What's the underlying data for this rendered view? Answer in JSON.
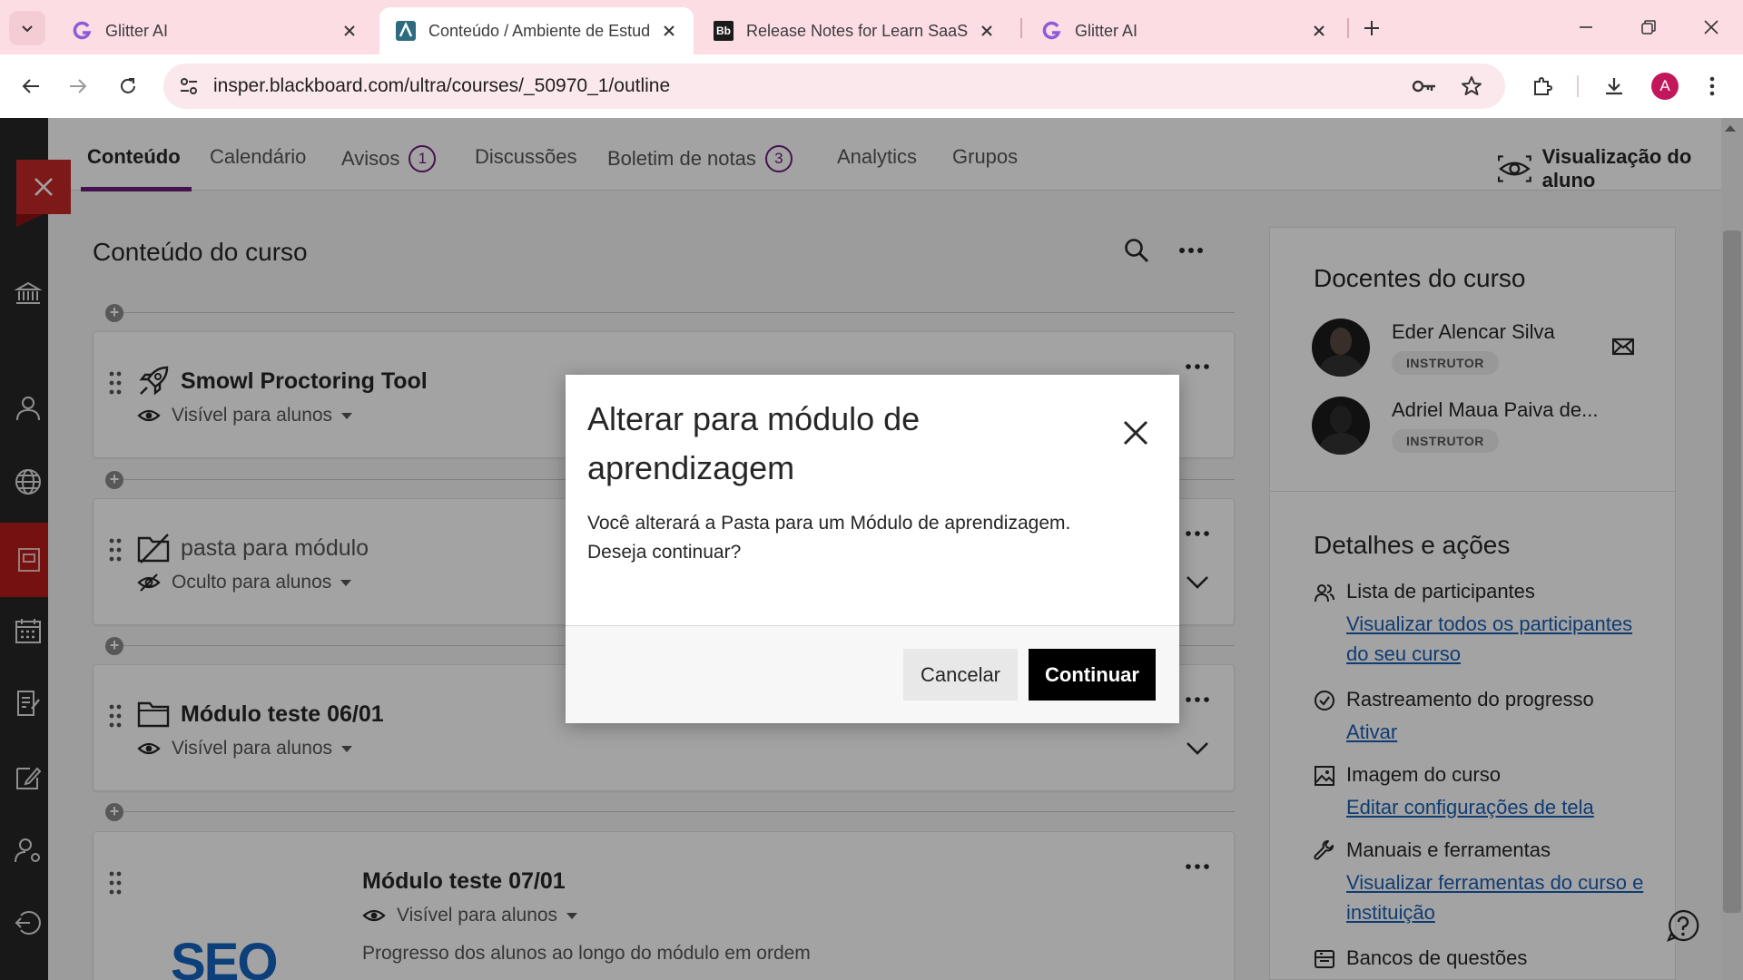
{
  "browser": {
    "tabs": [
      {
        "title": "Glitter AI",
        "favicon": "glitter-g-icon"
      },
      {
        "title": "Conteúdo / Ambiente de Estud",
        "favicon": "ambiente-icon"
      },
      {
        "title": "Release Notes for Learn SaaS | /",
        "favicon": "bb-icon",
        "favicon_text": "Bb"
      },
      {
        "title": "Glitter AI",
        "favicon": "glitter-g-icon"
      }
    ],
    "url": "insper.blackboard.com/ultra/courses/_50970_1/outline",
    "profile_initial": "A",
    "colors": {
      "tabstrip": "#fbdde3",
      "omnibox": "#fbe8ec",
      "profile": "#c2185b"
    }
  },
  "course_nav": {
    "tabs": [
      {
        "label": "Conteúdo"
      },
      {
        "label": "Calendário"
      },
      {
        "label": "Avisos",
        "badge": "1"
      },
      {
        "label": "Discussões"
      },
      {
        "label": "Boletim de notas",
        "badge": "3"
      },
      {
        "label": "Analytics"
      },
      {
        "label": "Grupos"
      }
    ],
    "student_view_label": "Visualização do aluno",
    "accent_color": "#6b1d7a"
  },
  "content": {
    "title": "Conteúdo do curso",
    "items": [
      {
        "title": "Smowl Proctoring Tool",
        "visibility": "Visível para alunos",
        "icon": "rocket-icon"
      },
      {
        "title": "pasta para módulo",
        "visibility": "Oculto para alunos",
        "icon": "folder-hidden-icon"
      },
      {
        "title": "Módulo teste 06/01",
        "visibility": "Visível para alunos",
        "icon": "folder-icon"
      },
      {
        "title": "Módulo teste 07/01",
        "visibility": "Visível para alunos",
        "description": "Progresso dos alunos ao longo do módulo em ordem",
        "image_text": "SEO"
      }
    ]
  },
  "sidebar": {
    "instructors_title": "Docentes do curso",
    "instructors": [
      {
        "name": "Eder Alencar Silva",
        "role": "INSTRUTOR"
      },
      {
        "name": "Adriel Maua Paiva de...",
        "role": "INSTRUTOR"
      }
    ],
    "details_title": "Detalhes e ações",
    "details": [
      {
        "title": "Lista de participantes",
        "link": "Visualizar todos os participantes do seu curso",
        "icon": "people-icon"
      },
      {
        "title": "Rastreamento do progresso",
        "link": "Ativar",
        "icon": "check-circle-icon"
      },
      {
        "title": "Imagem do curso",
        "link": "Editar configurações de tela",
        "icon": "image-icon"
      },
      {
        "title": "Manuais e ferramentas",
        "link": "Visualizar ferramentas do curso e instituição",
        "icon": "wrench-icon"
      },
      {
        "title": "Bancos de questões",
        "link": "",
        "icon": "bank-icon"
      }
    ]
  },
  "modal": {
    "title": "Alterar para módulo de aprendizagem",
    "body": "Você alterará a Pasta para um Módulo de aprendizagem. Deseja continuar?",
    "cancel_label": "Cancelar",
    "continue_label": "Continuar"
  }
}
